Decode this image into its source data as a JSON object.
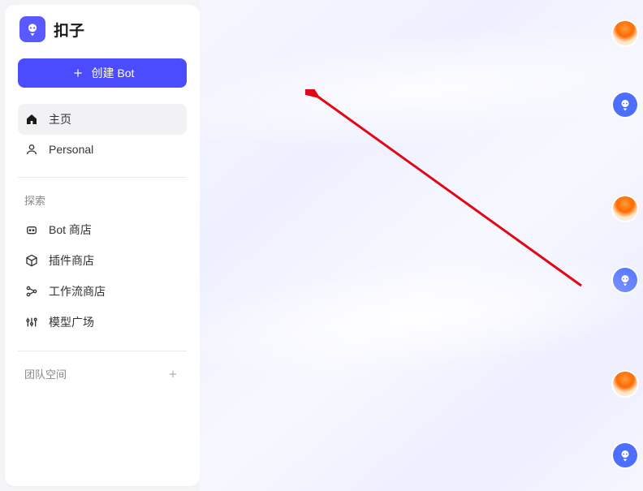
{
  "brand": {
    "name": "扣子"
  },
  "sidebar": {
    "create_label": "创建 Bot",
    "nav": [
      {
        "label": "主页"
      },
      {
        "label": "Personal"
      }
    ],
    "explore_label": "探索",
    "explore_items": [
      {
        "label": "Bot 商店"
      },
      {
        "label": "插件商店"
      },
      {
        "label": "工作流商店"
      },
      {
        "label": "模型广场"
      }
    ],
    "team_label": "团队空间"
  },
  "rail": {
    "items": [
      {
        "kind": "balloon"
      },
      {
        "kind": "bot"
      },
      {
        "kind": "balloon"
      },
      {
        "kind": "bot"
      },
      {
        "kind": "balloon"
      },
      {
        "kind": "bot"
      }
    ]
  },
  "annotation": {
    "arrow_color": "#e30613"
  }
}
